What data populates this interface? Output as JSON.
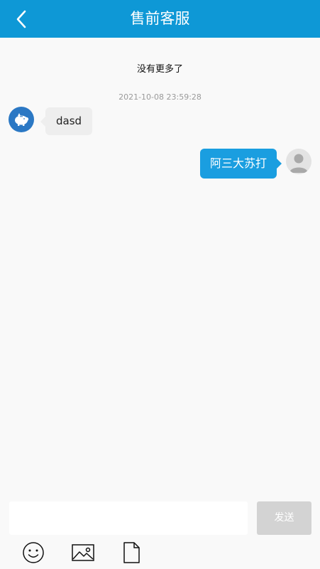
{
  "header": {
    "title": "售前客服",
    "background": "#0e98d6",
    "back_icon": "chevron-left-icon"
  },
  "chat": {
    "no_more_text": "没有更多了",
    "messages": [
      {
        "timestamp": "2021-10-08 23:59:28",
        "side": "left",
        "text": "dasd",
        "avatar_icon": "piggy-bank-icon"
      },
      {
        "side": "right",
        "text": "阿三大苏打",
        "avatar_icon": "default-user-icon",
        "bubble_color": "#1a9ee0"
      }
    ]
  },
  "composer": {
    "input_value": "",
    "send_label": "发送"
  },
  "toolbar": {
    "items": [
      {
        "icon": "emoji-icon"
      },
      {
        "icon": "image-icon"
      },
      {
        "icon": "file-icon"
      }
    ]
  }
}
